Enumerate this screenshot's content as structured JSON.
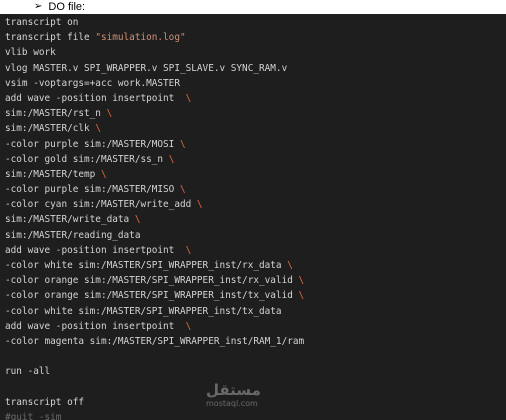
{
  "heading": {
    "bullet": "➢",
    "text": "DO file:"
  },
  "lines": [
    [
      "transcript on"
    ],
    [
      "transcript file ",
      "\"simulation.log\""
    ],
    [
      "vlib work"
    ],
    [
      "vlog MASTER.v SPI_WRAPPER.v SPI_SLAVE.v SYNC_RAM.v"
    ],
    [
      "vsim -voptargs=+acc work.MASTER"
    ],
    [
      "add wave -position insertpoint  ",
      "\\"
    ],
    [
      "sim:/MASTER/rst_n ",
      "\\"
    ],
    [
      "sim:/MASTER/clk ",
      "\\"
    ],
    [
      "-color purple sim:/MASTER/MOSI ",
      "\\"
    ],
    [
      "-color gold sim:/MASTER/ss_n ",
      "\\"
    ],
    [
      "sim:/MASTER/temp ",
      "\\"
    ],
    [
      "-color purple sim:/MASTER/MISO ",
      "\\"
    ],
    [
      "-color cyan sim:/MASTER/write_add ",
      "\\"
    ],
    [
      "sim:/MASTER/write_data ",
      "\\"
    ],
    [
      "sim:/MASTER/reading_data"
    ],
    [
      "add wave -position insertpoint  ",
      "\\"
    ],
    [
      "-color white sim:/MASTER/SPI_WRAPPER_inst/rx_data ",
      "\\"
    ],
    [
      "-color orange sim:/MASTER/SPI_WRAPPER_inst/rx_valid ",
      "\\"
    ],
    [
      "-color orange sim:/MASTER/SPI_WRAPPER_inst/tx_valid ",
      "\\"
    ],
    [
      "-color white sim:/MASTER/SPI_WRAPPER_inst/tx_data"
    ],
    [
      "add wave -position insertpoint  ",
      "\\"
    ],
    [
      "-color magenta sim:/MASTER/SPI_WRAPPER_inst/RAM_1/ram"
    ],
    [
      ""
    ],
    [
      "run -all"
    ],
    [
      ""
    ],
    [
      "transcript off"
    ],
    [
      "#quit -sim"
    ]
  ],
  "watermark": {
    "arabic": "مستقل",
    "latin": "mostaql.com"
  }
}
